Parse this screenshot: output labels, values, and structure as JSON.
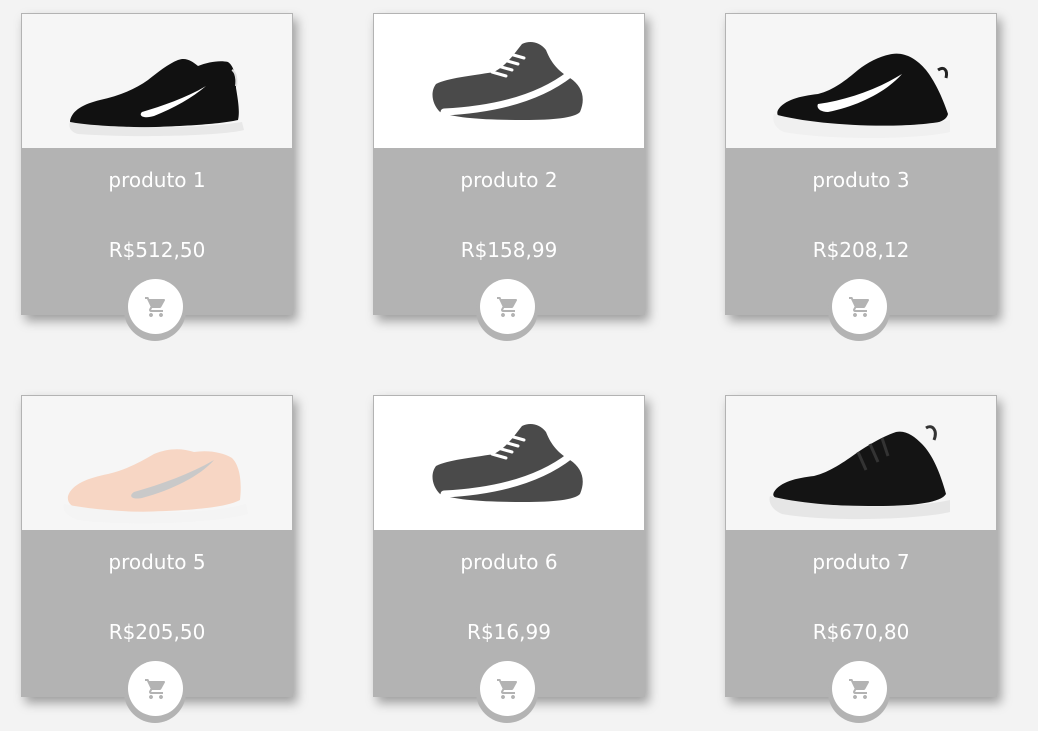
{
  "products": [
    {
      "name": "produto 1",
      "price": "R$512,50",
      "image": "black-running-shoe",
      "cart_icon": "shopping-cart-icon"
    },
    {
      "name": "produto 2",
      "price": "R$158,99",
      "image": "shoe-placeholder-icon",
      "cart_icon": "shopping-cart-icon"
    },
    {
      "name": "produto 3",
      "price": "R$208,12",
      "image": "black-white-high-shoe",
      "cart_icon": "shopping-cart-icon"
    },
    {
      "name": "produto 5",
      "price": "R$205,50",
      "image": "peach-running-shoe",
      "cart_icon": "shopping-cart-icon"
    },
    {
      "name": "produto 6",
      "price": "R$16,99",
      "image": "shoe-placeholder-icon",
      "cart_icon": "shopping-cart-icon"
    },
    {
      "name": "produto 7",
      "price": "R$670,80",
      "image": "black-training-shoe",
      "cart_icon": "shopping-cart-icon"
    }
  ],
  "colors": {
    "page_background": "#f3f3f3",
    "card_background": "#b3b3b3",
    "text": "#ffffff",
    "cart_icon": "#b3b3b3",
    "placeholder_shoe": "#4a4a4a"
  }
}
